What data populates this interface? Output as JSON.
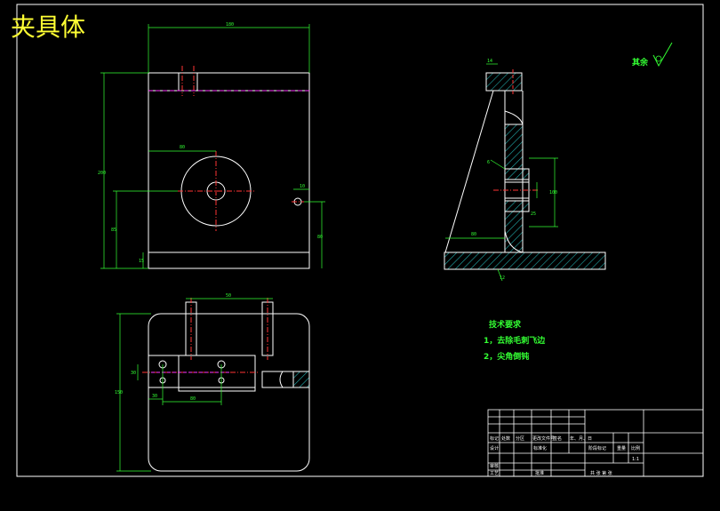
{
  "title": "夹具体",
  "surface_finish_note": "其余",
  "technical_requirements": {
    "heading": "技术要求",
    "items": [
      "1，去除毛刺飞边",
      "2，尖角倒钝"
    ]
  },
  "title_block": {
    "row_labels": [
      "标记",
      "处数",
      "分区",
      "更改文件号",
      "签名",
      "年、月、日"
    ],
    "design_label": "设计",
    "standardization_label": "标准化",
    "stage_label": "阶段标记",
    "weight_label": "重量",
    "scale_label": "比例",
    "scale_value": "1:1",
    "review_label": "审核",
    "process_label": "工艺",
    "approve_label": "批准",
    "sheet_label": "共 张 第 张"
  },
  "dimensions": {
    "top_width": "180",
    "overall_height": "200",
    "bore_offset": "80",
    "left_low": "85",
    "bottom_base": "15",
    "right_height": "80",
    "hole_small": "10",
    "side_top": "14",
    "side_offset": "80",
    "side_height": "100",
    "side_small": "25",
    "side_angle": "6",
    "side_base": "12",
    "bottom_top": "50",
    "bottom_left": "30",
    "bottom_span": "80",
    "bottom_height": "150",
    "bottom_small": "30"
  },
  "colors": {
    "background": "#000000",
    "outline": "#ffffff",
    "dimension": "#33ff33",
    "centerline": "#ff3333",
    "hidden": "#ff33ff",
    "title": "#ffff33",
    "hatch": "#22aaaa"
  }
}
